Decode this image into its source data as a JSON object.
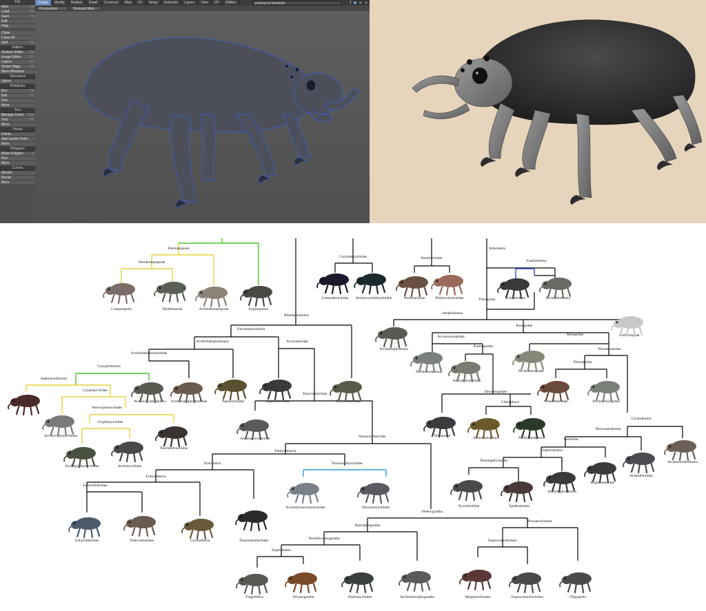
{
  "app": {
    "tabs": [
      "Create",
      "Modify",
      "Multiply",
      "Detail",
      "Construct",
      "Map",
      "UV",
      "Setup",
      "Selection",
      "Layers",
      "View",
      "I/O",
      "Utilities"
    ],
    "active_tab": "Create",
    "scene_name": "peteropod domestic",
    "layer_number": "1",
    "viewport_mode": "Perspective",
    "shading_mode": "Textured Wire",
    "toolbar": [
      {
        "head": "File",
        "items": [
          [
            "New",
            "^N"
          ],
          [
            "Load",
            "^O"
          ],
          [
            "Save",
            "^S"
          ],
          [
            "Edit",
            ""
          ],
          [
            "Help",
            ""
          ]
        ]
      },
      {
        "head": "",
        "items": [
          [
            "Close",
            ""
          ],
          [
            "Close All",
            ""
          ],
          [
            "Quit",
            "^Q"
          ]
        ]
      },
      {
        "head": "Editors",
        "items": [
          [
            "Surface Editor",
            "F5"
          ],
          [
            "Image Editor",
            "F6"
          ],
          [
            "Layers",
            "F7"
          ],
          [
            "Vertex Maps",
            "F8"
          ],
          [
            "More Windows",
            ""
          ]
        ]
      },
      {
        "head": "Selections",
        "items": [
          [
            "Select",
            ""
          ]
        ]
      },
      {
        "head": "Primitives",
        "items": [
          [
            "Box",
            "^X"
          ],
          [
            "Ball",
            "^O"
          ],
          [
            "Disc",
            ""
          ],
          [
            "More",
            ""
          ]
        ]
      },
      {
        "head": "Text",
        "items": [
          [
            "Manage Fonts",
            "F10"
          ],
          [
            "Text",
            "^W"
          ],
          [
            "More",
            ""
          ]
        ]
      },
      {
        "head": "Points",
        "items": [
          [
            "Points",
            ""
          ],
          [
            "Add Center Point",
            ""
          ],
          [
            "More",
            ""
          ]
        ]
      },
      {
        "head": "Polygons",
        "items": [
          [
            "Make Polygon",
            "p"
          ],
          [
            "Pen",
            ""
          ],
          [
            "More",
            ""
          ]
        ]
      },
      {
        "head": "Curves",
        "items": [
          [
            "Sketch",
            ""
          ],
          [
            "Bezier",
            ""
          ],
          [
            "More",
            ""
          ]
        ]
      }
    ]
  },
  "tree": {
    "labels": {
      "dermatopoda": "Dermatopoda",
      "neodermatopoda": "Neodermatopoda",
      "compsopoda": "Compsopoda",
      "rhabdopoda": "Rhabdopoda",
      "archedermatopoda": "Archedermatopoda",
      "euplatyptera": "Euplatyptera",
      "corythobrachidae": "Corythobrachidae",
      "camarabrachidae": "Camarabrachidae",
      "archecorythobrachidae": "Archecorythobrachidae",
      "neobrachidae": "Neobrachidae",
      "neobrachinae": "Neobrachinae",
      "phalacrobrachidae": "Phalacrobrachidae",
      "allodontia": "Allodontia",
      "euallodontia": "Euallodontia",
      "eriotherinae": "Eriotherinae",
      "archeallodontia": "Archeallodontia",
      "theropoda": "Theropoda",
      "amphidontia": "Amphidontia",
      "eutheropoda": "Eutheropoda",
      "archeamphidontia": "Archeamphidontia",
      "xenopidae": "Xenopidae",
      "archeoxenopidae": "Archeoxenopidae",
      "stenopidae": "Stenopidae",
      "archexenopsinae": "Archexenopsinae",
      "eurenopidae": "Eurenopidae",
      "ankistrobrachidae": "Ankistrobrachidae",
      "archestenopidae": "Archestenopidae",
      "neostenopidae": "Neostenopidae",
      "peloropidae": "Peloropidae",
      "amesotheriidae": "Amesotheriidae",
      "archepeloropidae": "Archepeloropidae",
      "neoxenopidae": "Neoxenopidae",
      "chelaphora": "Chelaphora",
      "teleopidae": "Teleopidae",
      "stenochelaphora": "Stenochelaphora",
      "pachychelaphora": "Pachychelaphora",
      "ceratodontia": "Ceratodontia",
      "neoceratodontia": "Neoceratodontia",
      "isodontia": "Isodontia",
      "elaphrodontia": "Elaphrodontia",
      "neoelaphrodontia": "Neoelaphrodontia",
      "xyrodontidae": "Xyrodontidae",
      "spathodontia": "Spathodontia",
      "archelaphrodontia": "Archelaphrodontia",
      "kophodontidae": "Kophodontidae",
      "arattodontidae": "Arattodontidae",
      "archeoceratodontia": "Archeoceratodontia",
      "rhamphodontia": "Rhamphodontia",
      "eurhamphodontia": "Eurhamphodontia",
      "archerhamphodontia": "Archerhamphodontia",
      "acrocheiridae": "Acrocheiridae",
      "archerhamphodontidae": "Archerhamphodontidae",
      "coryphodontia": "Coryphodontia",
      "septentrioformes": "Septentrioformes",
      "cryptonychidae": "Cryptonychidae",
      "archecoryphodontia": "Archecoryphodontia",
      "archerhamphodontinae": "Archerhamphodontinae",
      "apodomorpha": "Apodomorpha",
      "apatocheiridae": "Apatocheiridae",
      "oryctocheiridae": "Oryctocheiridae",
      "eiacrocheiridae": "Eiacrocheiridae",
      "archecryptonychidae": "Archecryptonychidae",
      "neocryptonychidae": "Neocryptonychidae",
      "glyphonychidae": "Glyphonychidae",
      "theristobrachidae": "Theristobrachidae",
      "archeglyphonychidae": "Archeglyphonychidae",
      "archonychidae": "Archonychidae",
      "archeacrocheiridae": "Archeacrocheiridae",
      "neoacrocheiridae": "Neoacrocheiridae",
      "panhylotheria": "Panhylotheria",
      "thrinaxorhynchidae": "Thrinaxorhynchidae",
      "hylotheria": "Hylotheria",
      "archethrinaxorhynchidae": "Archethrinaxorhynchidae",
      "dictyorhynchidae": "Dictyorhynchidae",
      "euhylotheria": "Euhylotheria",
      "euhylotheriidae": "Euhylotheriidae",
      "euhylotherinae": "Euhylotherinae",
      "pelecodontidae": "Pelecodontidae",
      "gyrinotheria": "Gyrinotheria",
      "thaumatotheriidae": "Thaumatotheriidae",
      "heterognatha": "Heterognatha",
      "distrophognatha": "Distrophognatha",
      "procaesoformes": "Procaesoformes",
      "neodistrophognatha": "Neodistrophognatha",
      "euprocaesoformes": "Euprocaesoformes",
      "daptodontia": "Daptodontia",
      "flagellifera": "Flagellifera",
      "dryptognatha": "Dryptognatha",
      "hadronychidae": "Hadronychidae",
      "archedistrophognatha": "Archedistrophognatha",
      "megantroformes": "Megantroformes",
      "euprocaesoformidae": "Euprocaesoformidae",
      "oligopoda": "Oligopoda"
    }
  }
}
